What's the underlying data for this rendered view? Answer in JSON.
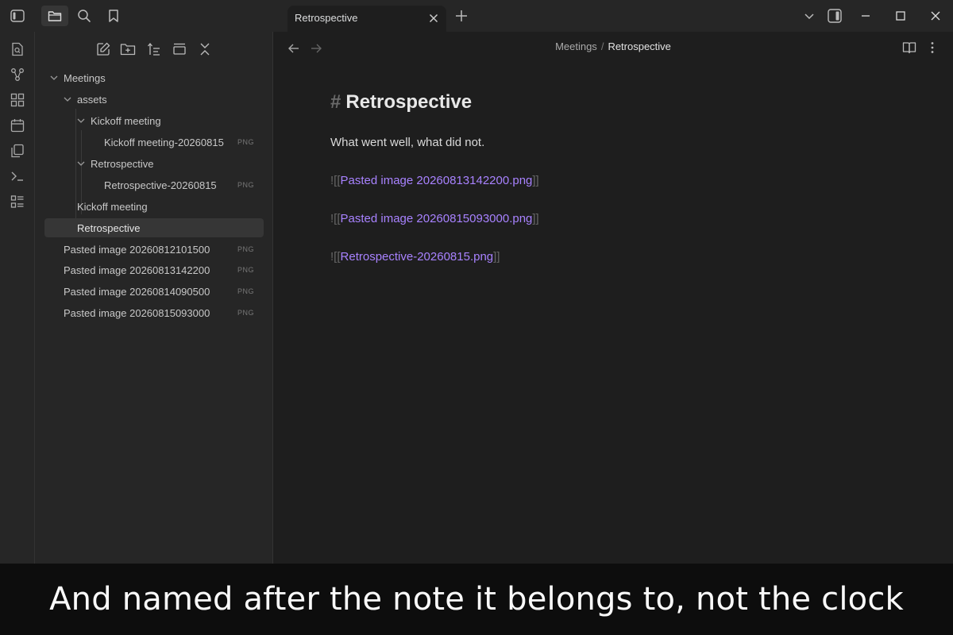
{
  "tab": {
    "title": "Retrospective"
  },
  "sidebar": {
    "tree": [
      {
        "label": "Meetings",
        "type": "folder"
      },
      {
        "label": "assets",
        "type": "folder"
      },
      {
        "label": "Kickoff meeting",
        "type": "folder"
      },
      {
        "label": "Kickoff meeting-20260815",
        "type": "file",
        "ext": "PNG"
      },
      {
        "label": "Retrospective",
        "type": "folder"
      },
      {
        "label": "Retrospective-20260815",
        "type": "file",
        "ext": "PNG"
      },
      {
        "label": "Kickoff meeting",
        "type": "note"
      },
      {
        "label": "Retrospective",
        "type": "note",
        "selected": true
      },
      {
        "label": "Pasted image 20260812101500",
        "type": "file",
        "ext": "PNG"
      },
      {
        "label": "Pasted image 20260813142200",
        "type": "file",
        "ext": "PNG"
      },
      {
        "label": "Pasted image 20260814090500",
        "type": "file",
        "ext": "PNG"
      },
      {
        "label": "Pasted image 20260815093000",
        "type": "file",
        "ext": "PNG"
      }
    ]
  },
  "main": {
    "breadcrumb": {
      "parent": "Meetings",
      "separator": "/",
      "current": "Retrospective"
    },
    "heading_hash": "#",
    "heading": "Retrospective",
    "paragraph": "What went well, what did not.",
    "embeds": [
      {
        "prefix": "![[",
        "target": "Pasted image 20260813142200.png",
        "suffix": "]]"
      },
      {
        "prefix": "![[",
        "target": "Pasted image 20260815093000.png",
        "suffix": "]]"
      },
      {
        "prefix": "![[",
        "target": "Retrospective-20260815.png",
        "suffix": "]]"
      }
    ]
  },
  "caption": "And named after the note it belongs to, not the clock",
  "colors": {
    "accent": "#a882ff",
    "background": "#1e1e1e",
    "sidebar": "#262626"
  }
}
